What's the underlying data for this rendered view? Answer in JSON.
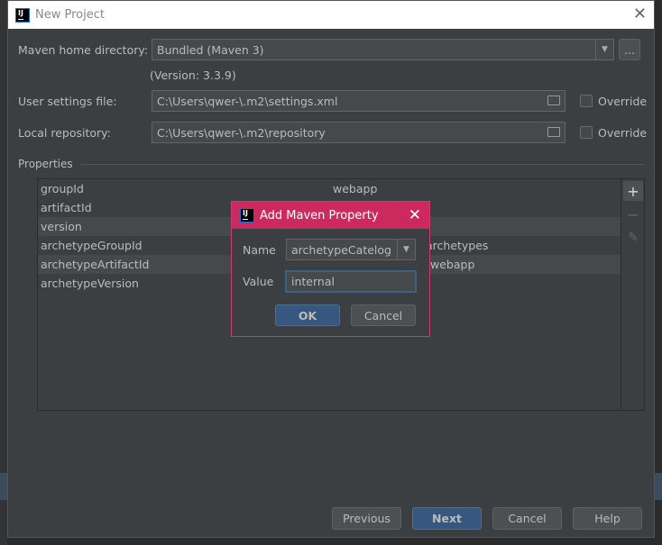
{
  "window": {
    "title": "New Project",
    "close_icon": "close-icon"
  },
  "maven": {
    "home_label": "Maven home directory:",
    "home_value": "Bundled (Maven 3)",
    "browse_label": "...",
    "version": "(Version: 3.3.9)",
    "settings_label": "User settings file:",
    "settings_value": "C:\\Users\\qwer-\\.m2\\settings.xml",
    "settings_override": "Override",
    "repo_label": "Local repository:",
    "repo_value": "C:\\Users\\qwer-\\.m2\\repository",
    "repo_override": "Override"
  },
  "properties": {
    "label": "Properties",
    "rows": [
      {
        "key": "groupId",
        "value": "webapp"
      },
      {
        "key": "artifactId",
        "value": ""
      },
      {
        "key": "version",
        "value": ""
      },
      {
        "key": "archetypeGroupId",
        "value": "archetypes"
      },
      {
        "key": "archetypeArtifactId",
        "value": "webapp"
      },
      {
        "key": "archetypeVersion",
        "value": ""
      }
    ]
  },
  "dialog": {
    "title": "Add Maven Property",
    "name_label": "Name",
    "name_value": "archetypeCatelog",
    "value_label": "Value",
    "value_value": "internal",
    "ok": "OK",
    "cancel": "Cancel",
    "title_color": "#cc2a5e"
  },
  "footer": {
    "previous": "Previous",
    "next": "Next",
    "cancel": "Cancel",
    "help": "Help"
  }
}
